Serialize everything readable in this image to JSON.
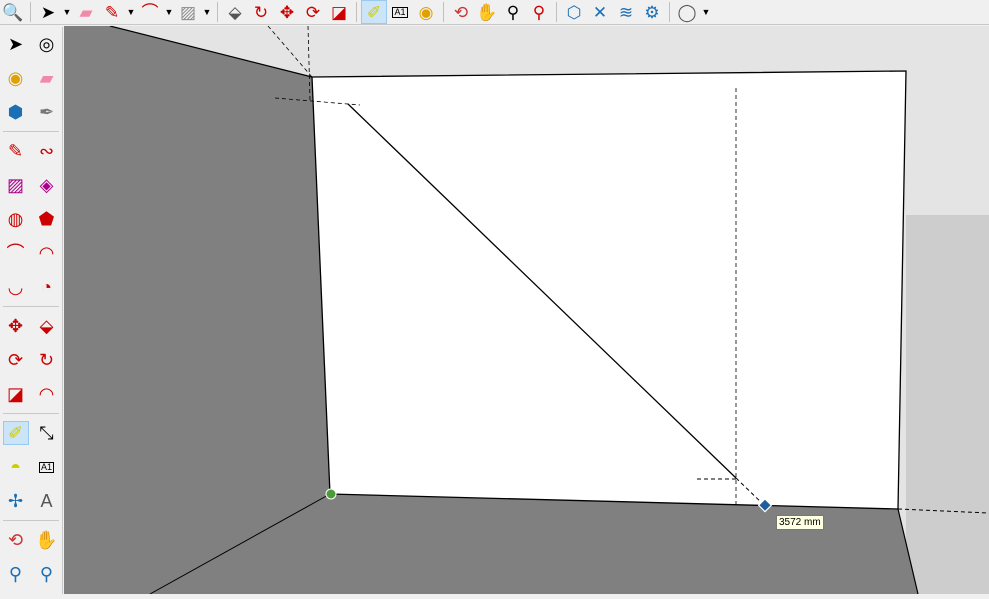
{
  "toolbar": {
    "top": [
      {
        "name": "zoom-window-icon",
        "g": "🔍"
      },
      {
        "name": "select-icon",
        "g": "➤",
        "dd": true
      },
      {
        "name": "eraser-icon",
        "g": "▰",
        "c": "#f08aa8"
      },
      {
        "name": "pencil-line-icon",
        "g": "✎",
        "c": "#c00",
        "dd": true
      },
      {
        "name": "arc-icon",
        "g": "⌒",
        "c": "#c00",
        "dd": true
      },
      {
        "name": "rectangle-icon",
        "g": "▨",
        "c": "#888",
        "dd": true
      },
      {
        "name": "push-pull-icon",
        "g": "⬙",
        "c": "#555"
      },
      {
        "name": "follow-me-icon",
        "g": "↻",
        "c": "#c00"
      },
      {
        "name": "move-icon",
        "g": "✥",
        "c": "#c00"
      },
      {
        "name": "rotate-icon",
        "g": "⟳",
        "c": "#c00"
      },
      {
        "name": "scale-icon",
        "g": "◪",
        "c": "#c00"
      },
      {
        "name": "tape-measure-icon",
        "g": "✐",
        "c": "#cc0",
        "active": true
      },
      {
        "name": "text-label-icon",
        "g": "A1",
        "c": "#000"
      },
      {
        "name": "paint-bucket-icon",
        "g": "◉",
        "c": "#e0a000"
      },
      {
        "name": "orbit-icon",
        "g": "⟲",
        "c": "#c33"
      },
      {
        "name": "pan-icon",
        "g": "✋",
        "c": "#e8c890"
      },
      {
        "name": "zoom-icon",
        "g": "⚲",
        "c": "#000"
      },
      {
        "name": "zoom-extents-icon",
        "g": "⚲",
        "c": "#c00"
      },
      {
        "name": "warehouse-icon",
        "g": "⬡",
        "c": "#1a6fb5"
      },
      {
        "name": "extension-warehouse-icon",
        "g": "✕",
        "c": "#1a6fb5"
      },
      {
        "name": "layout-send-icon",
        "g": "≋",
        "c": "#1a6fb5"
      },
      {
        "name": "extension-manager-icon",
        "g": "⚙",
        "c": "#1a6fb5"
      },
      {
        "name": "account-icon",
        "g": "◯",
        "c": "#555",
        "dd": true
      }
    ]
  },
  "left_toolbar": [
    [
      {
        "name": "select-icon",
        "g": "➤",
        "c": "#000"
      },
      {
        "name": "orbit-icon",
        "g": "◎",
        "c": "#000"
      }
    ],
    [
      {
        "name": "paint-bucket-icon",
        "g": "◉",
        "c": "#e0a000"
      },
      {
        "name": "eraser-icon",
        "g": "▰",
        "c": "#f08aa8"
      }
    ],
    [
      {
        "name": "component-icon",
        "g": "⬢",
        "c": "#1a6fb5"
      },
      {
        "name": "tag-icon",
        "g": "✒",
        "c": "#777"
      }
    ],
    "sep",
    [
      {
        "name": "line-icon",
        "g": "✎",
        "c": "#c00"
      },
      {
        "name": "freehand-icon",
        "g": "∾",
        "c": "#c00"
      }
    ],
    [
      {
        "name": "rectangle-icon",
        "g": "▨",
        "c": "#a08"
      },
      {
        "name": "rotated-rectangle-icon",
        "g": "◈",
        "c": "#a08"
      }
    ],
    [
      {
        "name": "circle-icon",
        "g": "◍",
        "c": "#c00"
      },
      {
        "name": "polygon-icon",
        "g": "⬟",
        "c": "#c00"
      }
    ],
    [
      {
        "name": "arc-icon",
        "g": "⌒",
        "c": "#c00"
      },
      {
        "name": "two-point-arc-icon",
        "g": "◠",
        "c": "#c00"
      }
    ],
    [
      {
        "name": "three-point-arc-icon",
        "g": "◡",
        "c": "#c00"
      },
      {
        "name": "pie-icon",
        "g": "◔",
        "c": "#c00"
      }
    ],
    "sep",
    [
      {
        "name": "move-icon",
        "g": "✥",
        "c": "#c00"
      },
      {
        "name": "push-pull-icon",
        "g": "⬙",
        "c": "#c00"
      }
    ],
    [
      {
        "name": "rotate-icon",
        "g": "⟳",
        "c": "#c00"
      },
      {
        "name": "follow-me-icon",
        "g": "↻",
        "c": "#c00"
      }
    ],
    [
      {
        "name": "scale-icon",
        "g": "◪",
        "c": "#c00"
      },
      {
        "name": "offset-icon",
        "g": "◠",
        "c": "#c00"
      }
    ],
    "sep",
    [
      {
        "name": "tape-measure-icon",
        "g": "✐",
        "c": "#cc0",
        "active": true
      },
      {
        "name": "dimension-icon",
        "g": "⤡",
        "c": "#000"
      }
    ],
    [
      {
        "name": "protractor-icon",
        "g": "◓",
        "c": "#cc0"
      },
      {
        "name": "text-icon",
        "g": "A1",
        "c": "#000"
      }
    ],
    [
      {
        "name": "axes-icon",
        "g": "✢",
        "c": "#1a6fb5"
      },
      {
        "name": "3d-text-icon",
        "g": "A",
        "c": "#555"
      }
    ],
    "sep",
    [
      {
        "name": "orbit-icon",
        "g": "⟲",
        "c": "#c33"
      },
      {
        "name": "pan-icon",
        "g": "✋",
        "c": "#e8c890"
      }
    ],
    [
      {
        "name": "zoom-icon",
        "g": "⚲",
        "c": "#1a6fb5"
      },
      {
        "name": "zoom-window-icon",
        "g": "⚲",
        "c": "#1a6fb5"
      }
    ]
  ],
  "measurement": {
    "tooltip": "3572 mm"
  },
  "colors": {
    "face": "#ffffff",
    "ground": "#808080",
    "sky": "#e4e4e4",
    "horizon": "#cdcdcd",
    "endpoint": "#4c9a3a",
    "cursor": "#1f5f9e"
  }
}
